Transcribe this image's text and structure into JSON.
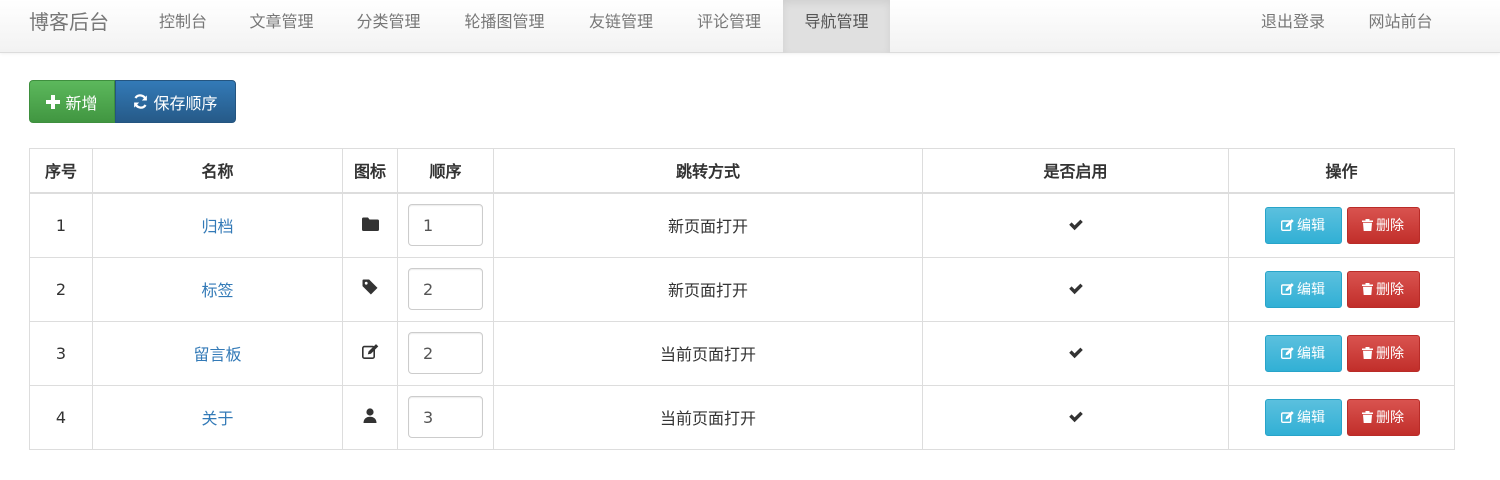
{
  "navbar": {
    "brand": "博客后台",
    "items": [
      {
        "label": "控制台"
      },
      {
        "label": "文章管理"
      },
      {
        "label": "分类管理"
      },
      {
        "label": "轮播图管理"
      },
      {
        "label": "友链管理"
      },
      {
        "label": "评论管理"
      },
      {
        "label": "导航管理",
        "active": true
      }
    ],
    "right": [
      {
        "label": "退出登录"
      },
      {
        "label": "网站前台"
      }
    ]
  },
  "toolbar": {
    "add_label": "新增",
    "save_order_label": "保存顺序"
  },
  "table": {
    "headers": [
      "序号",
      "名称",
      "图标",
      "顺序",
      "跳转方式",
      "是否启用",
      "操作"
    ],
    "rows": [
      {
        "index": "1",
        "name": "归档",
        "icon": "folder-icon",
        "order": "1",
        "jump": "新页面打开",
        "enabled": true
      },
      {
        "index": "2",
        "name": "标签",
        "icon": "tag-icon",
        "order": "2",
        "jump": "新页面打开",
        "enabled": true
      },
      {
        "index": "3",
        "name": "留言板",
        "icon": "edit-icon",
        "order": "2",
        "jump": "当前页面打开",
        "enabled": true
      },
      {
        "index": "4",
        "name": "关于",
        "icon": "user-icon",
        "order": "3",
        "jump": "当前页面打开",
        "enabled": true
      }
    ],
    "edit_label": "编辑",
    "delete_label": "删除"
  }
}
